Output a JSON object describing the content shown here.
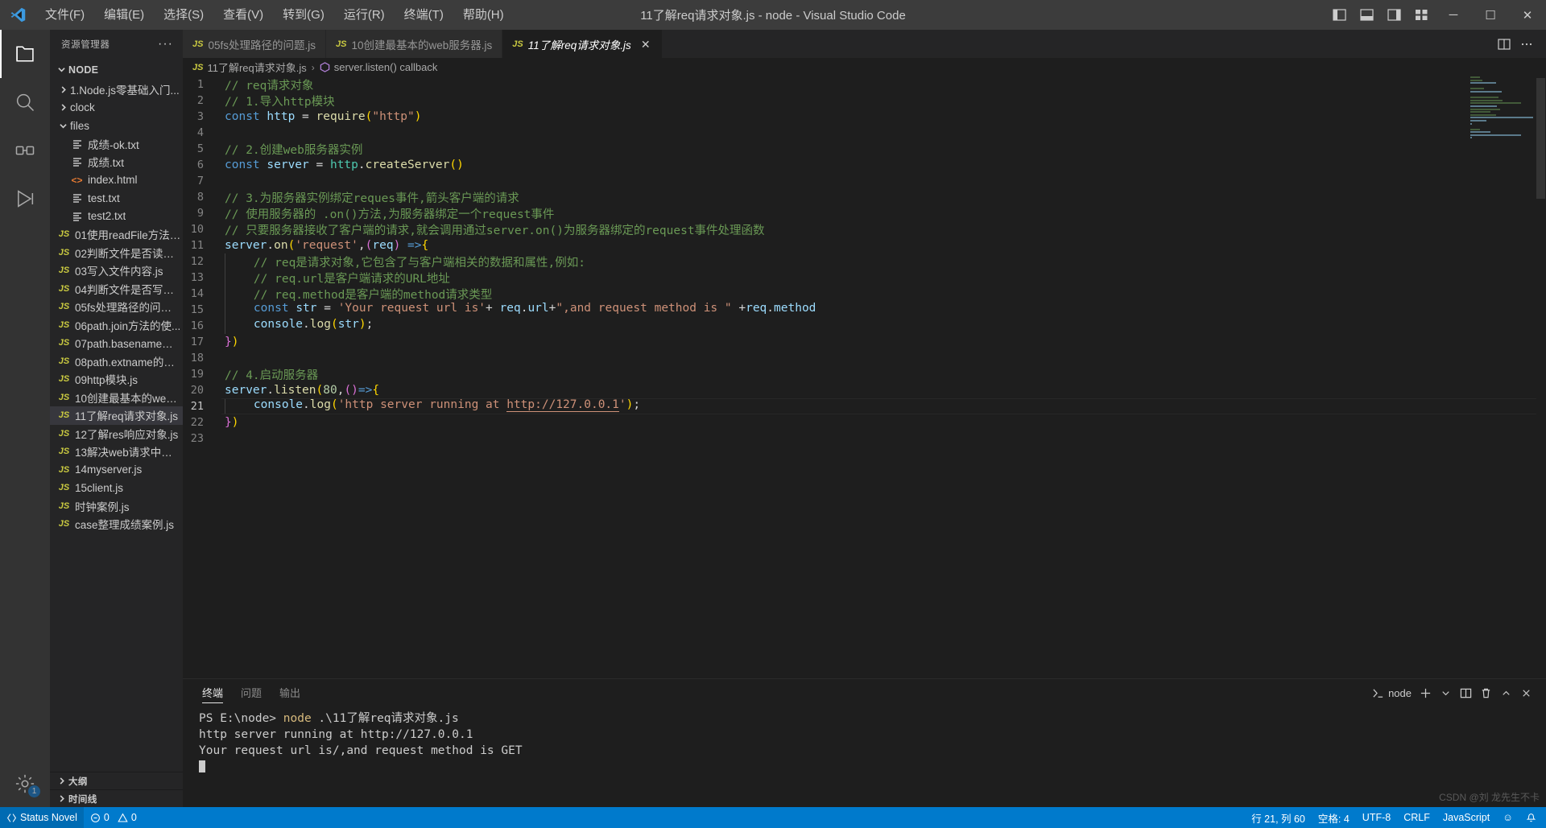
{
  "titlebar": {
    "window_title": "11了解req请求对象.js - node - Visual Studio Code",
    "menu": [
      {
        "label": "文件(F)",
        "name": "menu-file"
      },
      {
        "label": "编辑(E)",
        "name": "menu-edit"
      },
      {
        "label": "选择(S)",
        "name": "menu-selection"
      },
      {
        "label": "查看(V)",
        "name": "menu-view"
      },
      {
        "label": "转到(G)",
        "name": "menu-go"
      },
      {
        "label": "运行(R)",
        "name": "menu-run"
      },
      {
        "label": "终端(T)",
        "name": "menu-terminal"
      },
      {
        "label": "帮助(H)",
        "name": "menu-help"
      }
    ],
    "minimize": "─",
    "maximize": "☐",
    "close": "✕"
  },
  "activitybar": {
    "items": [
      "explorer-icon",
      "search-icon",
      "source-control-icon",
      "run-debug-icon",
      "settings-gear-icon"
    ],
    "settings_badge": "1"
  },
  "sidebar": {
    "header_title": "资源管理器",
    "more_actions": "···",
    "root_label": "NODE",
    "tree": [
      {
        "label": "1.Node.js零基础入门...",
        "type": "folder",
        "expanded": false,
        "indent": 1
      },
      {
        "label": "clock",
        "type": "folder",
        "expanded": false,
        "indent": 1
      },
      {
        "label": "files",
        "type": "folder",
        "expanded": true,
        "indent": 1
      },
      {
        "label": "成绩-ok.txt",
        "type": "txt",
        "indent": 2
      },
      {
        "label": "成绩.txt",
        "type": "txt",
        "indent": 2
      },
      {
        "label": "index.html",
        "type": "html",
        "indent": 2
      },
      {
        "label": "test.txt",
        "type": "txt",
        "indent": 2
      },
      {
        "label": "test2.txt",
        "type": "txt",
        "indent": 2
      },
      {
        "label": "01使用readFile方法读...",
        "type": "js",
        "indent": 1
      },
      {
        "label": "02判断文件是否读取...",
        "type": "js",
        "indent": 1
      },
      {
        "label": "03写入文件内容.js",
        "type": "js",
        "indent": 1
      },
      {
        "label": "04判断文件是否写入...",
        "type": "js",
        "indent": 1
      },
      {
        "label": "05fs处理路径的问题.js",
        "type": "js",
        "indent": 1
      },
      {
        "label": "06path.join方法的使...",
        "type": "js",
        "indent": 1
      },
      {
        "label": "07path.basename方法...",
        "type": "js",
        "indent": 1
      },
      {
        "label": "08path.extname的使...",
        "type": "js",
        "indent": 1
      },
      {
        "label": "09http模块.js",
        "type": "js",
        "indent": 1
      },
      {
        "label": "10创建最基本的web...",
        "type": "js",
        "indent": 1
      },
      {
        "label": "11了解req请求对象.js",
        "type": "js",
        "indent": 1,
        "selected": true
      },
      {
        "label": "12了解res响应对象.js",
        "type": "js",
        "indent": 1
      },
      {
        "label": "13解决web请求中文...",
        "type": "js",
        "indent": 1
      },
      {
        "label": "14myserver.js",
        "type": "js",
        "indent": 1
      },
      {
        "label": "15client.js",
        "type": "js",
        "indent": 1
      },
      {
        "label": "时钟案例.js",
        "type": "js",
        "indent": 1
      },
      {
        "label": "case整理成绩案例.js",
        "type": "js",
        "indent": 1
      }
    ],
    "sections": [
      {
        "label": "大纲",
        "name": "outline-section"
      },
      {
        "label": "时间线",
        "name": "timeline-section"
      }
    ]
  },
  "tabs": [
    {
      "label": "05fs处理路径的问题.js",
      "icon": "JS",
      "active": false
    },
    {
      "label": "10创建最基本的web服务器.js",
      "icon": "JS",
      "active": false
    },
    {
      "label": "11了解req请求对象.js",
      "icon": "JS",
      "active": true,
      "close": "✕"
    }
  ],
  "breadcrumb": {
    "file": "11了解req请求对象.js",
    "separator": "›",
    "symbol": "server.listen() callback",
    "file_icon": "JS",
    "symbol_icon": "function-symbol-icon"
  },
  "editor": {
    "lines": [
      {
        "n": 1,
        "tokens": [
          {
            "t": "// req请求对象",
            "c": "c-com"
          }
        ]
      },
      {
        "n": 2,
        "tokens": [
          {
            "t": "// 1.导入http模块",
            "c": "c-com"
          }
        ]
      },
      {
        "n": 3,
        "tokens": [
          {
            "t": "const ",
            "c": "c-key"
          },
          {
            "t": "http ",
            "c": "c-var"
          },
          {
            "t": "= ",
            "c": "c-op"
          },
          {
            "t": "require",
            "c": "c-fn"
          },
          {
            "t": "(",
            "c": "c-par"
          },
          {
            "t": "\"http\"",
            "c": "c-str"
          },
          {
            "t": ")",
            "c": "c-par"
          }
        ]
      },
      {
        "n": 4,
        "tokens": []
      },
      {
        "n": 5,
        "tokens": [
          {
            "t": "// 2.创建web服务器实例",
            "c": "c-com"
          }
        ]
      },
      {
        "n": 6,
        "tokens": [
          {
            "t": "const ",
            "c": "c-key"
          },
          {
            "t": "server ",
            "c": "c-var"
          },
          {
            "t": "= ",
            "c": "c-op"
          },
          {
            "t": "http",
            "c": "c-cls"
          },
          {
            "t": ".",
            "c": "c-op"
          },
          {
            "t": "createServer",
            "c": "c-fn"
          },
          {
            "t": "()",
            "c": "c-par"
          }
        ]
      },
      {
        "n": 7,
        "tokens": []
      },
      {
        "n": 8,
        "tokens": [
          {
            "t": "// 3.为服务器实例绑定reques事件,箭头客户端的请求",
            "c": "c-com"
          }
        ]
      },
      {
        "n": 9,
        "tokens": [
          {
            "t": "// 使用服务器的 .on()方法,为服务器绑定一个request事件",
            "c": "c-com"
          }
        ]
      },
      {
        "n": 10,
        "tokens": [
          {
            "t": "// 只要服务器接收了客户端的请求,就会调用通过server.on()为服务器绑定的request事件处理函数",
            "c": "c-com"
          }
        ]
      },
      {
        "n": 11,
        "tokens": [
          {
            "t": "server",
            "c": "c-var"
          },
          {
            "t": ".",
            "c": "c-op"
          },
          {
            "t": "on",
            "c": "c-fn"
          },
          {
            "t": "(",
            "c": "c-par"
          },
          {
            "t": "'request'",
            "c": "c-str"
          },
          {
            "t": ",",
            "c": "c-op"
          },
          {
            "t": "(",
            "c": "c-par2"
          },
          {
            "t": "req",
            "c": "c-var"
          },
          {
            "t": ") ",
            "c": "c-par2"
          },
          {
            "t": "=>",
            "c": "c-key"
          },
          {
            "t": "{",
            "c": "c-par"
          }
        ]
      },
      {
        "n": 12,
        "indent": 1,
        "tokens": [
          {
            "t": "// req是请求对象,它包含了与客户端相关的数据和属性,例如:",
            "c": "c-com"
          }
        ]
      },
      {
        "n": 13,
        "indent": 1,
        "tokens": [
          {
            "t": "// req.url是客户端请求的URL地址",
            "c": "c-com"
          }
        ]
      },
      {
        "n": 14,
        "indent": 1,
        "tokens": [
          {
            "t": "// req.method是客户端的method请求类型",
            "c": "c-com"
          }
        ]
      },
      {
        "n": 15,
        "indent": 1,
        "tokens": [
          {
            "t": "const ",
            "c": "c-key"
          },
          {
            "t": "str ",
            "c": "c-var"
          },
          {
            "t": "= ",
            "c": "c-op"
          },
          {
            "t": "'Your request url is'",
            "c": "c-str"
          },
          {
            "t": "+ ",
            "c": "c-op"
          },
          {
            "t": "req",
            "c": "c-var"
          },
          {
            "t": ".",
            "c": "c-op"
          },
          {
            "t": "url",
            "c": "c-var"
          },
          {
            "t": "+",
            "c": "c-op"
          },
          {
            "t": "\",and request method is \"",
            "c": "c-str"
          },
          {
            "t": " +",
            "c": "c-op"
          },
          {
            "t": "req",
            "c": "c-var"
          },
          {
            "t": ".",
            "c": "c-op"
          },
          {
            "t": "method",
            "c": "c-var"
          }
        ]
      },
      {
        "n": 16,
        "indent": 1,
        "tokens": [
          {
            "t": "console",
            "c": "c-var"
          },
          {
            "t": ".",
            "c": "c-op"
          },
          {
            "t": "log",
            "c": "c-fn"
          },
          {
            "t": "(",
            "c": "c-par"
          },
          {
            "t": "str",
            "c": "c-var"
          },
          {
            "t": ")",
            "c": "c-par"
          },
          {
            "t": ";",
            "c": "c-op"
          }
        ]
      },
      {
        "n": 17,
        "tokens": [
          {
            "t": "}",
            "c": "c-par2"
          },
          {
            "t": ")",
            "c": "c-par"
          }
        ]
      },
      {
        "n": 18,
        "tokens": []
      },
      {
        "n": 19,
        "tokens": [
          {
            "t": "// 4.启动服务器",
            "c": "c-com"
          }
        ]
      },
      {
        "n": 20,
        "tokens": [
          {
            "t": "server",
            "c": "c-var"
          },
          {
            "t": ".",
            "c": "c-op"
          },
          {
            "t": "listen",
            "c": "c-fn"
          },
          {
            "t": "(",
            "c": "c-par"
          },
          {
            "t": "80",
            "c": "c-num"
          },
          {
            "t": ",",
            "c": "c-op"
          },
          {
            "t": "()",
            "c": "c-par2"
          },
          {
            "t": "=>",
            "c": "c-key"
          },
          {
            "t": "{",
            "c": "c-par"
          }
        ]
      },
      {
        "n": 21,
        "indent": 1,
        "current": true,
        "tokens": [
          {
            "t": "console",
            "c": "c-var"
          },
          {
            "t": ".",
            "c": "c-op"
          },
          {
            "t": "log",
            "c": "c-fn"
          },
          {
            "t": "(",
            "c": "c-par"
          },
          {
            "t": "'http server running at ",
            "c": "c-str"
          },
          {
            "t": "http://127.0.0.1",
            "c": "c-link"
          },
          {
            "t": "'",
            "c": "c-str"
          },
          {
            "t": ")",
            "c": "c-par"
          },
          {
            "t": ";",
            "c": "c-op"
          }
        ]
      },
      {
        "n": 22,
        "tokens": [
          {
            "t": "}",
            "c": "c-par2"
          },
          {
            "t": ")",
            "c": "c-par"
          }
        ]
      },
      {
        "n": 23,
        "tokens": []
      }
    ]
  },
  "panel": {
    "tabs": [
      {
        "label": "终端",
        "active": true
      },
      {
        "label": "问题",
        "active": false
      },
      {
        "label": "输出",
        "active": false
      }
    ],
    "shell_label": "node",
    "actions": [
      "new-terminal-icon",
      "chevron-down-icon",
      "split-terminal-icon",
      "trash-icon",
      "chevron-up-icon",
      "close-icon"
    ],
    "terminal_lines": [
      {
        "prompt": "PS E:\\node> ",
        "cmd": "node ",
        "rest": ".\\11了解req请求对象.js"
      },
      {
        "prompt": "",
        "cmd": "",
        "rest": "http server running at http://127.0.0.1"
      },
      {
        "prompt": "",
        "cmd": "",
        "rest": "Your request url is/,and request method is GET"
      }
    ]
  },
  "statusbar": {
    "remote_label": "Status Novel",
    "errors": "0",
    "warnings": "0",
    "cursor_position": "行 21, 列 60",
    "indentation": "空格: 4",
    "encoding": "UTF-8",
    "eol": "CRLF",
    "language": "JavaScript",
    "feedback": "☺",
    "bell": "🔔",
    "watermark": "CSDN @刘 龙先生不卡"
  }
}
